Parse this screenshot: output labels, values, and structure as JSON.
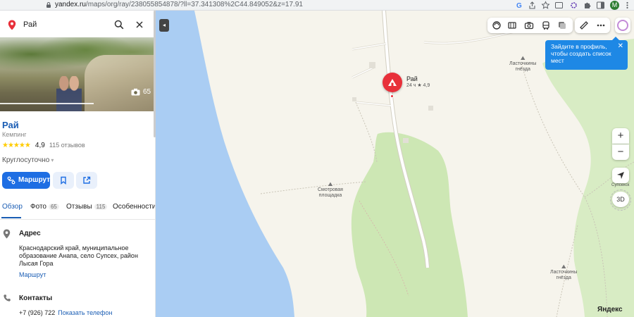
{
  "browser": {
    "url_prefix": "yandex.ru",
    "url_rest": "/maps/org/ray/238055854878/?ll=37.341308%2C44.849052&z=17.91",
    "profile_letter": "M"
  },
  "search": {
    "query": "Рай"
  },
  "photo": {
    "count": "65",
    "progress_fraction": 0.6
  },
  "place": {
    "name": "Рай",
    "category": "Кемпинг",
    "stars": "★★★★★",
    "rating": "4,9",
    "reviews": "115 отзывов",
    "hours": "Круглосуточно",
    "hours_chevron": "▾"
  },
  "actions": {
    "route_label": "Маршрут"
  },
  "tabs": [
    {
      "label": "Обзор"
    },
    {
      "label": "Фото",
      "count": "65"
    },
    {
      "label": "Отзывы",
      "count": "115"
    },
    {
      "label": "Особенности"
    }
  ],
  "address": {
    "heading": "Адрес",
    "text": "Краснодарский край, муниципальное образование Анапа, село Супсех, район Лысая Гора",
    "route_link": "Маршрут"
  },
  "contacts": {
    "heading": "Контакты",
    "phone": "+7 (926) 722",
    "show_phone": "Показать телефон"
  },
  "map": {
    "poi_name": "Рай",
    "poi_meta": "24 ч  ★ 4,9",
    "labels": {
      "lookout": "Смотровая\nплощадка",
      "swallows_top": "Ласточкины\nгнёзда",
      "swallows_bottom": "Ласточкины\nгнёзда",
      "supsekh": "Супсехск"
    },
    "tooltip": "Зайдите в профиль, чтобы создать список мест",
    "tooltip_close": "✕",
    "zoom_in": "+",
    "zoom_out": "−",
    "btn_3d": "3D",
    "collapse": "◂",
    "logo_main": "Яндекс",
    "colors": {
      "water": "#aacdf3",
      "forest": "#cde7b4",
      "land": "#f6f4ec",
      "accent": "#1e6ee3",
      "poi": "#e8303a"
    }
  }
}
